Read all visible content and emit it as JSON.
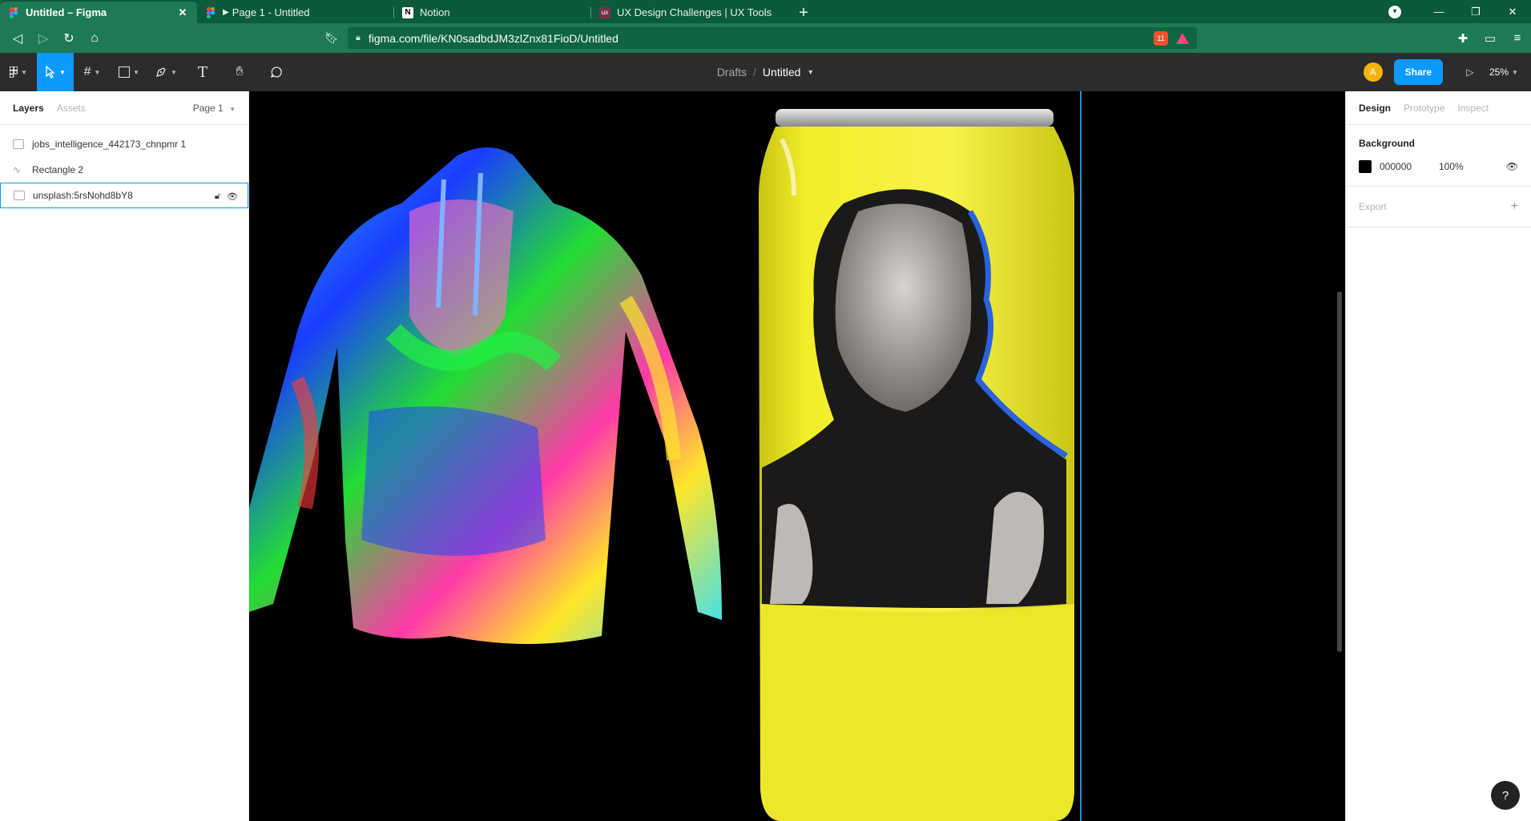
{
  "browser": {
    "tabs": [
      {
        "title": "Untitled – Figma",
        "icon": "figma-icon",
        "active": true
      },
      {
        "title": "Page 1 - Untitled",
        "icon": "figma-icon",
        "active": false
      },
      {
        "title": "Notion",
        "icon": "notion-icon",
        "active": false
      },
      {
        "title": "UX Design Challenges | UX Tools",
        "icon": "uxtools-icon",
        "active": false
      }
    ],
    "url": "figma.com/file/KN0sadbdJM3zlZnx81FioD/Untitled",
    "brave_badge": "11"
  },
  "figma": {
    "breadcrumb_folder": "Drafts",
    "breadcrumb_sep": "/",
    "file_name": "Untitled",
    "avatar_initial": "A",
    "share_label": "Share",
    "zoom": "25%"
  },
  "left_panel": {
    "tabs": [
      "Layers",
      "Assets"
    ],
    "page": "Page 1",
    "layers": [
      {
        "name": "jobs_intelligence_442173_chnpmr 1",
        "type": "image"
      },
      {
        "name": "Rectangle 2",
        "type": "vector"
      },
      {
        "name": "unsplash:5rsNohd8bY8",
        "type": "image",
        "selected": true
      }
    ]
  },
  "right_panel": {
    "tabs": [
      "Design",
      "Prototype",
      "Inspect"
    ],
    "background_label": "Background",
    "background_hex": "000000",
    "background_opacity": "100%",
    "export_label": "Export"
  },
  "colors": {
    "tab_strip": "#0b5a3c",
    "address_bar": "#1e7a55",
    "figma_toolbar": "#2c2c2c",
    "accent": "#0d99ff",
    "can_yellow": "#f2ee2a",
    "guide": "#2a8fd8"
  }
}
